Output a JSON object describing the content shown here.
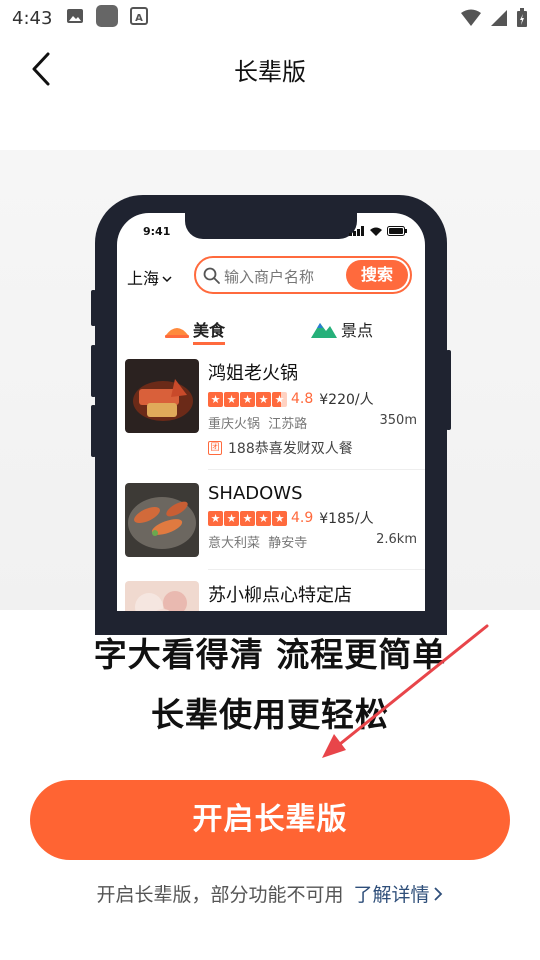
{
  "status_bar": {
    "time": "4:43"
  },
  "header": {
    "title": "长辈版",
    "back_icon": "back-chevron-icon"
  },
  "preview": {
    "phone_time": "9:41",
    "city": "上海",
    "search_placeholder": "输入商户名称",
    "search_button": "搜索",
    "categories": [
      {
        "label": "美食",
        "icon": "food-icon"
      },
      {
        "label": "景点",
        "icon": "scenic-icon"
      }
    ],
    "restaurants": [
      {
        "name": "鸿姐老火锅",
        "rating": "4.8",
        "price": "¥220/人",
        "cuisine": "重庆火锅",
        "area": "江苏路",
        "distance": "350m",
        "deal_tag": "团",
        "deal": "188恭喜发财双人餐"
      },
      {
        "name": "SHADOWS",
        "rating": "4.9",
        "price": "¥185/人",
        "cuisine": "意大利菜",
        "area": "静安寺",
        "distance": "2.6km"
      },
      {
        "name": "苏小柳点心特定店"
      }
    ]
  },
  "headline": {
    "line1": "字大看得清 流程更简单",
    "line2": "长辈使用更轻松"
  },
  "main_button": "开启长辈版",
  "footer": {
    "text": "开启长辈版，部分功能不可用",
    "link": "了解详情"
  },
  "colors": {
    "accent": "#ff6433",
    "annotation_arrow": "#e8454a"
  }
}
